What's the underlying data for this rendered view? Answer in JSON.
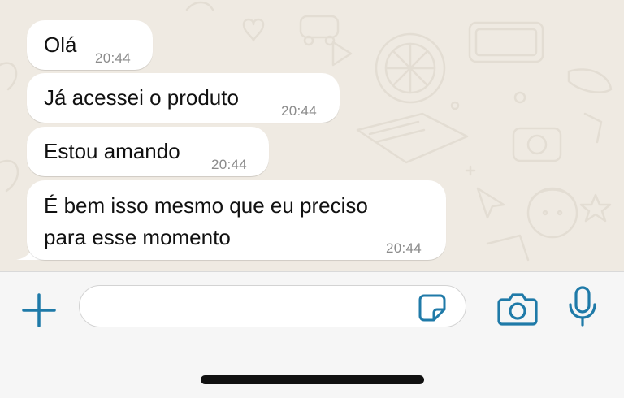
{
  "chat": {
    "messages": [
      {
        "text": "Olá",
        "time": "20:44"
      },
      {
        "text": "Já acessei o produto",
        "time": "20:44"
      },
      {
        "text": "Estou amando",
        "time": "20:44"
      },
      {
        "line1": "É bem isso mesmo que eu preciso",
        "line2": "para esse momento",
        "time": "20:44"
      }
    ]
  },
  "composer": {
    "input_value": "",
    "placeholder": "",
    "icons": {
      "attach": "plus-icon",
      "sticker": "sticker-icon",
      "camera": "camera-icon",
      "mic": "microphone-icon"
    }
  },
  "colors": {
    "chat_background": "#efeae2",
    "bubble": "#ffffff",
    "accent": "#1f7aa8",
    "time_text": "#8b8b8b",
    "bar_background": "#f6f6f6"
  }
}
